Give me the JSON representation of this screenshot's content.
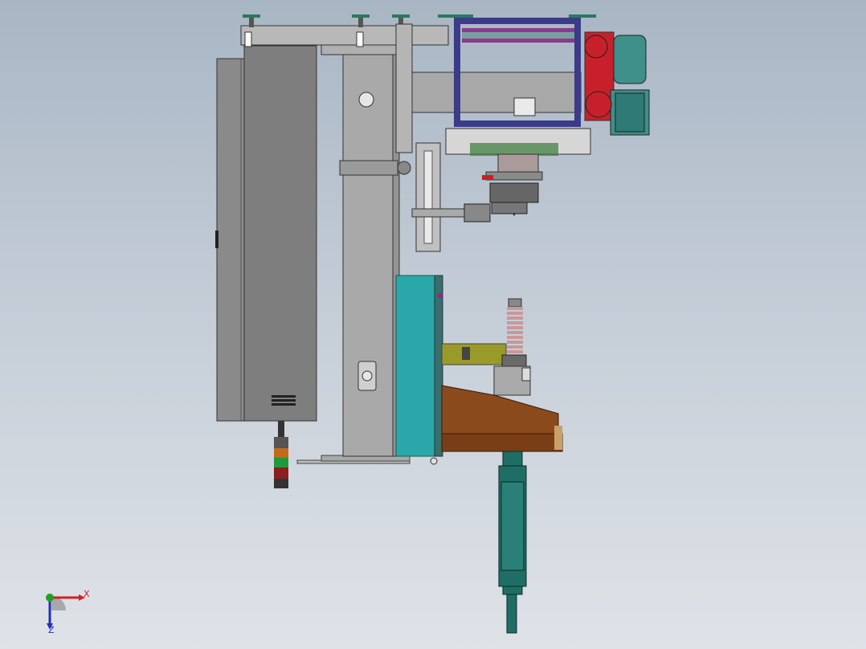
{
  "viewport": {
    "background_top": "#a8b6c4",
    "background_bottom": "#dfe3e8",
    "model": {
      "parts": [
        "electrical-cabinet",
        "vertical-column",
        "top-beam",
        "linear-guide",
        "gearmotor",
        "drive-frame",
        "rotary-head",
        "cyan-housing",
        "spring-assembly",
        "brown-support",
        "signal-tower",
        "pneumatic-cylinder"
      ],
      "colors": {
        "cabinet": "#8a8a8a",
        "column": "#a9a9a9",
        "motor_teal": "#3f8f8a",
        "gear_red": "#c8202a",
        "frame_blue": "#3b3b8a",
        "housing_cyan": "#2aa7a8",
        "support_brown": "#8a4a1c",
        "cylinder_green": "#1f6e66",
        "bracket_olive": "#9a9a2a"
      }
    }
  },
  "triad": {
    "x_label": "X",
    "z_label": "Z",
    "x_color": "#d42020",
    "z_color": "#2030c0",
    "y_color": "#20a020"
  }
}
